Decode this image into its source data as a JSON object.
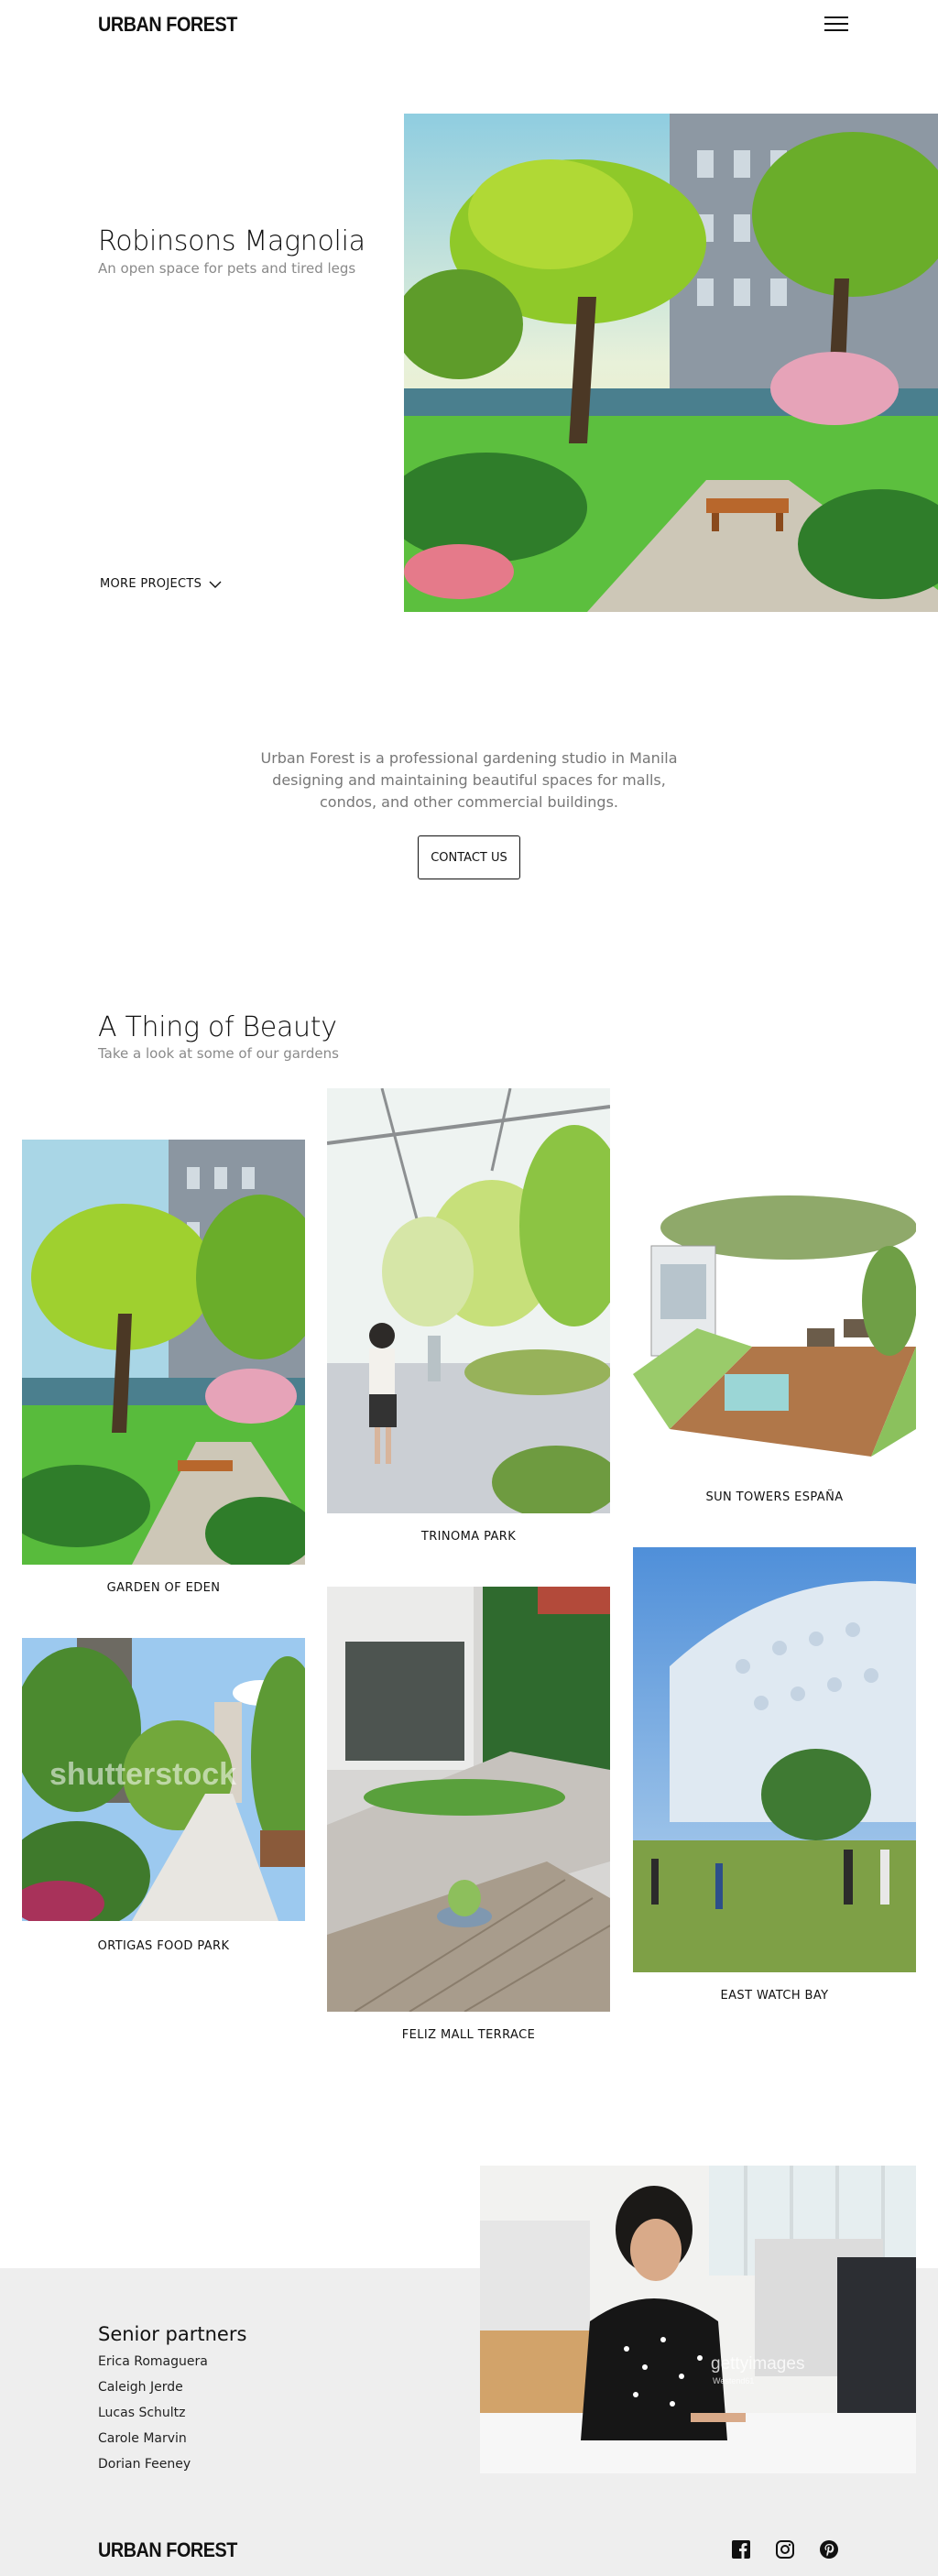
{
  "header": {
    "logo": "URBAN FOREST",
    "menu_icon": "hamburger-menu-icon"
  },
  "hero": {
    "title": "Robinsons Magnolia",
    "subtitle": "An open space for pets and tired legs",
    "more_label": "MORE PROJECTS"
  },
  "intro": {
    "text": "Urban Forest is a professional gardening studio in Manila designing and maintaining beautiful spaces for malls, condos, and other commercial buildings.",
    "cta": "CONTACT US"
  },
  "gallery": {
    "title": "A Thing of Beauty",
    "subtitle": "Take a look at some of our gardens",
    "items": [
      {
        "caption": "GARDEN OF EDEN"
      },
      {
        "caption": "TRINOMA PARK"
      },
      {
        "caption": "SUN TOWERS ESPAÑA"
      },
      {
        "caption": "ORTIGAS FOOD PARK",
        "watermark": "shutterstock"
      },
      {
        "caption": "FELIZ MALL TERRACE"
      },
      {
        "caption": "EAST WATCH BAY"
      }
    ]
  },
  "partners": {
    "title": "Senior partners",
    "names": [
      "Erica Romaguera",
      "Caleigh Jerde",
      "Lucas Schultz",
      "Carole Marvin",
      "Dorian Feeney"
    ],
    "photo_watermark": "gettyimages",
    "photo_watermark_sub": "Westend61"
  },
  "footer": {
    "logo": "URBAN FOREST",
    "social": [
      "facebook-icon",
      "instagram-icon",
      "pinterest-icon"
    ]
  },
  "colors": {
    "accent": "#111111",
    "muted": "#8a8a8a",
    "band": "#eeeeee"
  }
}
